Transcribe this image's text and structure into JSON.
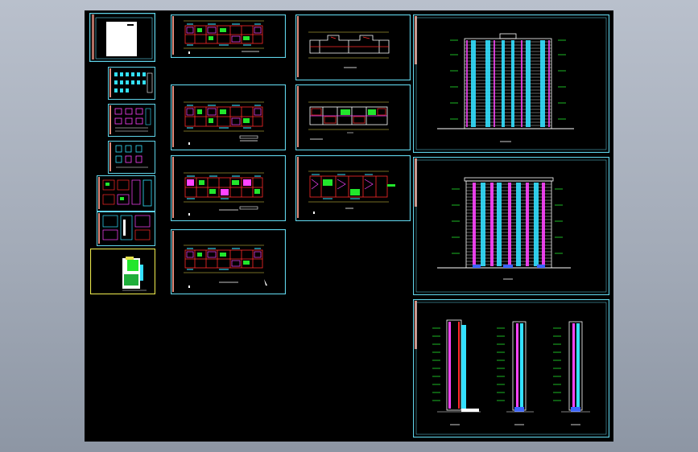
{
  "viewport": {
    "background": "gradient-gray",
    "model_space_color": "#000000"
  },
  "colors": {
    "sheet_border": "#5fd3e8",
    "selected_sheet_border": "#e5e24a",
    "title_block": "#e08a7a",
    "wall_red": "#ff2a2a",
    "wall_magenta": "#ff44ff",
    "window_cyan": "#33e0ff",
    "room_green": "#22e62c",
    "line_white": "#ffffff",
    "line_yellow": "#e6d84a"
  },
  "sheets": {
    "cover": {
      "kind": "cover"
    },
    "index_sheets": [
      {
        "kind": "legend-table"
      },
      {
        "kind": "detail-schedule"
      },
      {
        "kind": "detail-schedule"
      },
      {
        "kind": "detail-plan"
      },
      {
        "kind": "detail-plan"
      },
      {
        "kind": "site-plan",
        "selected": true
      }
    ],
    "floor_plans": [
      {
        "kind": "floor-plan"
      },
      {
        "kind": "floor-plan"
      },
      {
        "kind": "floor-plan"
      },
      {
        "kind": "floor-plan"
      },
      {
        "kind": "roof-plan"
      },
      {
        "kind": "floor-plan"
      },
      {
        "kind": "floor-plan"
      }
    ],
    "elevations": [
      {
        "kind": "front-elevation"
      },
      {
        "kind": "rear-elevation"
      },
      {
        "kind": "side-elevations-and-section"
      }
    ]
  }
}
